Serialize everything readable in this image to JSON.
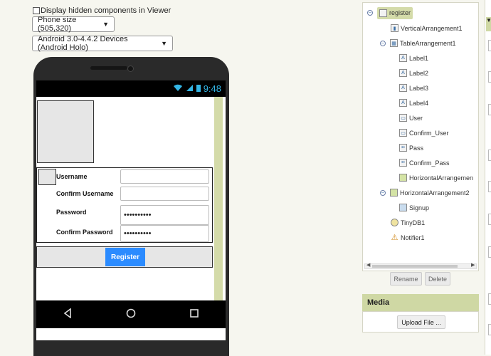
{
  "viewer": {
    "hidden_label": "Display hidden components in Viewer",
    "size_select": "Phone size (505,320)",
    "theme_select": "Android 3.0-4.4.2 Devices (Android Holo)"
  },
  "phone": {
    "time": "9:48",
    "form": {
      "labels": [
        "Username",
        "Confirm Username",
        "Password",
        "Confirm Password"
      ],
      "password_value": "••••••••••",
      "confirm_password_value": "••••••••••"
    },
    "register_label": "Register"
  },
  "components": {
    "root": "register",
    "items": [
      "VerticalArrangement1",
      "TableArrangement1",
      "Label1",
      "Label2",
      "Label3",
      "Label4",
      "User",
      "Confirm_User",
      "Pass",
      "Confirm_Pass",
      "HorizontalArrangemen",
      "HorizontalArrangement2",
      "Signup",
      "TinyDB1",
      "Notifier1"
    ],
    "rename_label": "Rename",
    "delete_label": "Delete"
  },
  "media": {
    "title": "Media",
    "upload_label": "Upload File ..."
  },
  "colors": {
    "accent": "#cfd8a4",
    "button_blue": "#2b8bff",
    "status_blue": "#33b5e5"
  }
}
